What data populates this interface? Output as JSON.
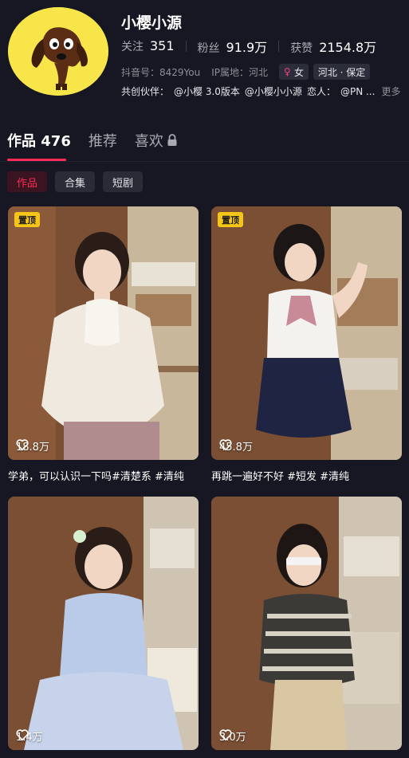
{
  "profile": {
    "username": "小樱小源",
    "stats": [
      {
        "label": "关注",
        "value": "351"
      },
      {
        "label": "粉丝",
        "value": "91.9万"
      },
      {
        "label": "获赞",
        "value": "2154.8万"
      }
    ],
    "douyin_id": "抖音号：8429You",
    "ip_location": "IP属地：河北",
    "gender_tag": "女",
    "region_tag": "河北 · 保定",
    "partners": [
      "共创伙伴：",
      "@小樱 3.0版本",
      "@小樱小小源",
      "恋人：",
      "@PN ..."
    ],
    "more": "更多"
  },
  "tabs": [
    {
      "label": "作品 476",
      "active": true
    },
    {
      "label": "推荐",
      "active": false
    },
    {
      "label": "喜欢",
      "active": false,
      "icon": "lock-icon"
    }
  ],
  "chips": [
    {
      "label": "作品",
      "active": true
    },
    {
      "label": "合集",
      "active": false
    },
    {
      "label": "短剧",
      "active": false
    }
  ],
  "videos": [
    {
      "pinned": "置顶",
      "likes": "18.8万",
      "caption": "学弟，可以认识一下吗#清楚系 #清纯"
    },
    {
      "pinned": "置顶",
      "likes": "45.8万",
      "caption": "再跳一遍好不好 #短发 #清纯"
    },
    {
      "pinned": "",
      "likes": "1.4万",
      "caption": ""
    },
    {
      "pinned": "",
      "likes": "3.0万",
      "caption": ""
    }
  ],
  "colors": {
    "accent": "#fe2c55",
    "background": "#161722",
    "pin": "#f5c518"
  }
}
